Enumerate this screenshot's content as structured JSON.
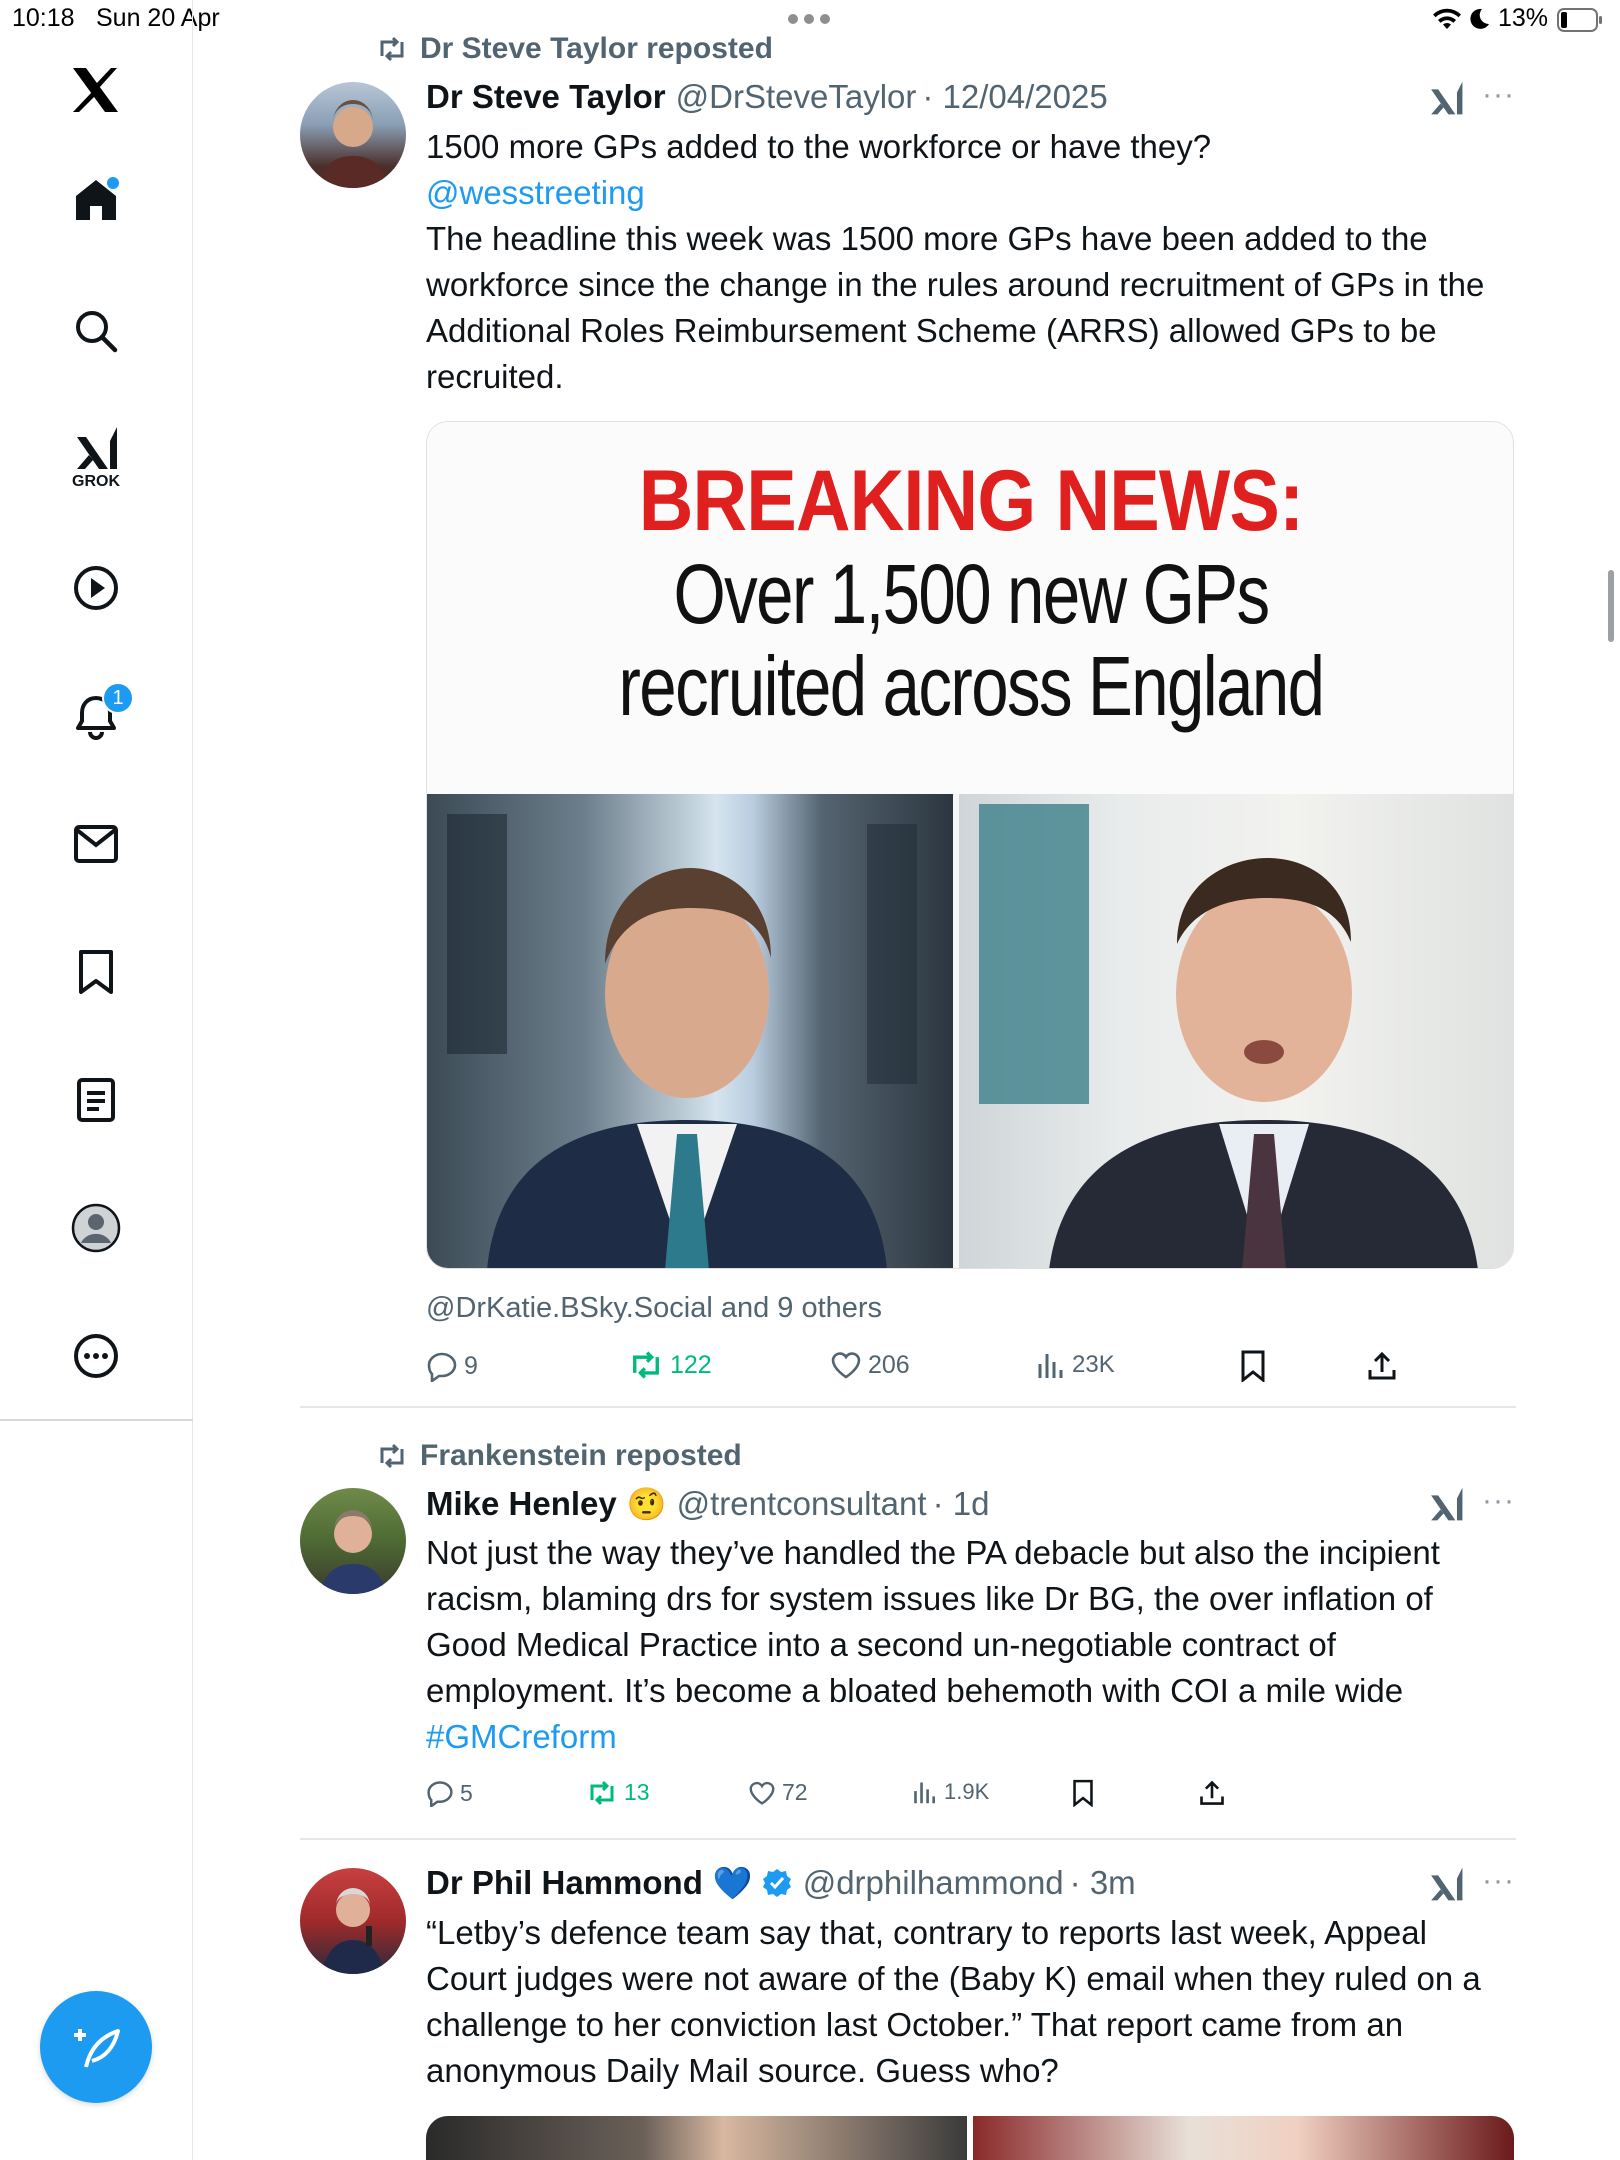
{
  "status_bar": {
    "time": "10:18",
    "date": "Sun 20 Apr",
    "battery": "13%"
  },
  "sidebar": {
    "logo": "x-logo-icon",
    "grok_label": "GROK",
    "notification_count": "1",
    "items": [
      "home-icon",
      "search-icon",
      "grok-icon",
      "video-icon",
      "notifications-icon",
      "messages-icon",
      "bookmarks-icon",
      "lists-icon",
      "profile-icon",
      "more-icon"
    ],
    "compose": "compose-icon"
  },
  "feed": {
    "tweets": [
      {
        "repost_label": "Dr Steve Taylor reposted",
        "name": "Dr Steve Taylor",
        "handle": "@DrSteveTaylor",
        "time": "· 12/04/2025",
        "text_1": "1500 more GPs added to the workforce or have they?",
        "mention": "@wesstreeting",
        "text_2": "The headline this week was 1500 more GPs have been added to the workforce since the change in the rules around recruitment of GPs in the Additional Roles Reimbursement Scheme (ARRS) allowed GPs to be recruited.",
        "media_headline": "BREAKING NEWS:",
        "media_subline_1": "Over 1,500 new GPs",
        "media_subline_2": "recruited across England",
        "tagged": "@DrKatie.BSky.Social and 9 others",
        "replies": "9",
        "reposts": "122",
        "likes": "206",
        "views": "23K"
      },
      {
        "repost_label": "Frankenstein reposted",
        "name": "Mike Henley",
        "emoji": "🤨",
        "handle": "@trentconsultant",
        "time": "· 1d",
        "text": "Not just the way they’ve handled the PA debacle but also the incipient racism, blaming drs for system issues like Dr BG, the over inflation of Good Medical Practice into a second un-negotiable contract of employment. It’s become a bloated behemoth with COI a mile wide",
        "hashtag": "#GMCreform",
        "replies": "5",
        "reposts": "13",
        "likes": "72",
        "views": "1.9K"
      },
      {
        "name": "Dr Phil Hammond",
        "emoji": "💙",
        "handle": "@drphilhammond",
        "time": "· 3m",
        "text": "“Letby’s defence team say that, contrary to reports last week, Appeal Court judges were not aware of the (Baby K) email when they ruled on a challenge to her conviction last October.” That report came from an anonymous Daily Mail source. Guess who?"
      }
    ]
  },
  "colors": {
    "accent": "#1d9bf0",
    "repost_green": "#00ba7c",
    "muted": "#536471",
    "breaking_red": "#e0201f"
  }
}
